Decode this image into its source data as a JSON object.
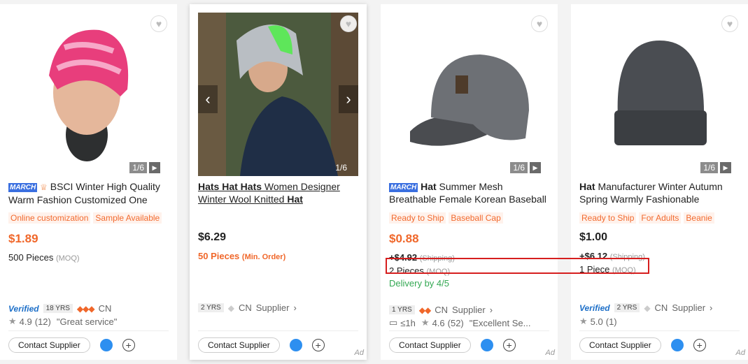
{
  "cards": [
    {
      "title_text": "BSCI Winter High Quality Warm Fashion Customized One",
      "march": "MARCH",
      "tags": [
        "Online customization",
        "Sample Available"
      ],
      "price": "$1.89",
      "moq_value": "500 Pieces",
      "moq_label": "(MOQ)",
      "verified": "Verified",
      "years": "18 YRS",
      "country": "CN",
      "rating": "4.9",
      "reviews": "(12)",
      "review_quote": "\"Great service\"",
      "image_counter": "1/6",
      "contact": "Contact Supplier"
    },
    {
      "title_parts": [
        "Hats Hat Hats",
        " Women Designer Winter Wool Knitted ",
        "Hat"
      ],
      "price": "$6.29",
      "moq_value": "50 Pieces",
      "moq_label": "(Min. Order)",
      "years": "2 YRS",
      "country": "CN",
      "supplier_label": "Supplier",
      "image_counter": "1/6",
      "contact": "Contact Supplier",
      "ad": "Ad"
    },
    {
      "title_bold": "Hat",
      "title_rest": " Summer Mesh Breathable Female Korean Baseball",
      "march": "MARCH",
      "tags": [
        "Ready to Ship",
        "Baseball Cap"
      ],
      "price": "$0.88",
      "shipping_value": "+$4.92",
      "shipping_label": "(Shipping)",
      "moq_value": "2 Pieces",
      "moq_label": "(MOQ)",
      "delivery": "Delivery by 4/5",
      "years": "1 YRS",
      "country": "CN",
      "supplier_label": "Supplier",
      "response": "≤1h",
      "rating": "4.6",
      "reviews": "(52)",
      "review_quote": "\"Excellent Se...",
      "image_counter": "1/6",
      "contact": "Contact Supplier",
      "ad": "Ad"
    },
    {
      "title_bold": "Hat",
      "title_rest": " Manufacturer Winter Autumn Spring Warmly Fashionable",
      "tags": [
        "Ready to Ship",
        "For Adults",
        "Beanie"
      ],
      "price": "$1.00",
      "shipping_value": "+$6.12",
      "shipping_label": "(Shipping)",
      "moq_value": "1 Piece",
      "moq_label": "(MOQ)",
      "verified": "Verified",
      "years": "2 YRS",
      "country": "CN",
      "supplier_label": "Supplier",
      "rating": "5.0",
      "reviews": "(1)",
      "image_counter": "1/6",
      "contact": "Contact Supplier",
      "ad": "Ad"
    }
  ],
  "colors": {
    "accent": "#f0672a",
    "verified": "#1d6fc8",
    "highlight": "#d61e1e"
  },
  "icons": [
    "heart-icon",
    "play-icon",
    "chevron-left-icon",
    "chevron-right-icon",
    "star-icon",
    "chat-icon",
    "plus-circle-icon",
    "diamond-icon"
  ]
}
